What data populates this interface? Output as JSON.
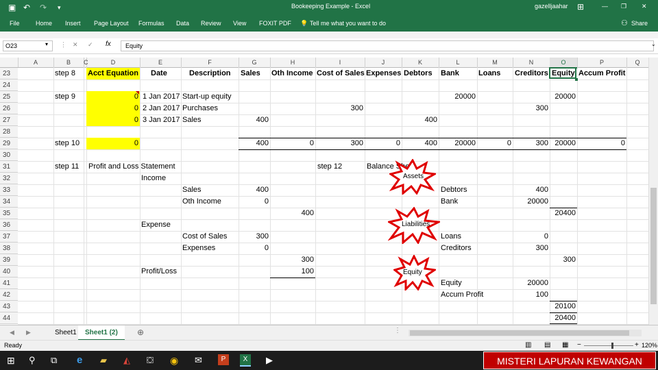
{
  "titlebar": {
    "title": "Bookeeping Example - Excel",
    "user": "gazelljaahar",
    "minimize": "—",
    "restore": "❐",
    "close": "✕"
  },
  "ribbon": {
    "tabs": [
      "File",
      "Home",
      "Insert",
      "Page Layout",
      "Formulas",
      "Data",
      "Review",
      "View",
      "FOXIT PDF"
    ],
    "tell_me": "Tell me what you want to do",
    "share": "Share"
  },
  "formula_bar": {
    "name_box": "O23",
    "fx_label": "fx",
    "value": "Equity"
  },
  "columns": [
    "A",
    "B",
    "C",
    "D",
    "E",
    "F",
    "G",
    "H",
    "I",
    "J",
    "K",
    "L",
    "M",
    "N",
    "O",
    "P",
    "Q"
  ],
  "rows": [
    "23",
    "24",
    "25",
    "26",
    "27",
    "28",
    "29",
    "30",
    "31",
    "32",
    "33",
    "34",
    "35",
    "36",
    "37",
    "38",
    "39",
    "40",
    "41",
    "42",
    "43",
    "44"
  ],
  "cells": {
    "b23": "step 8",
    "d23": "Acct Equation",
    "e23": "Date",
    "f23": "Description",
    "g23": "Sales",
    "h23": "Oth Income",
    "i23": "Cost of Sales",
    "j23": "Expenses",
    "k23": "Debtors",
    "l23": "Bank",
    "m23": "Loans",
    "n23": "Creditors",
    "o23": "Equity",
    "p23": "Accum Profit",
    "b25": "step 9",
    "d25": "0",
    "e25": "1 Jan 2017",
    "f25": "Start-up equity",
    "l25": "20000",
    "o25": "20000",
    "d26": "0",
    "e26": "2 Jan 2017",
    "f26": "Purchases",
    "i26": "300",
    "n26": "300",
    "d27": "0",
    "e27": "3 Jan 2017",
    "f27": "Sales",
    "g27": "400",
    "k27": "400",
    "b29": "step 10",
    "d29": "0",
    "g29": "400",
    "h29": "0",
    "i29": "300",
    "j29": "0",
    "k29": "400",
    "l29": "20000",
    "m29": "0",
    "n29": "300",
    "o29": "20000",
    "p29": "0",
    "b31": "step 11",
    "d31": "Profit and Loss Statement",
    "i31": "step 12",
    "j31": "Balance Sheet",
    "e32": "Income",
    "f33": "Sales",
    "g33": "400",
    "l33": "Debtors",
    "n33": "400",
    "f34": "Oth Income",
    "g34": "0",
    "l34": "Bank",
    "n34": "20000",
    "h35": "400",
    "o35": "20400",
    "e36": "Expense",
    "f37": "Cost of Sales",
    "g37": "300",
    "l37": "Loans",
    "n37": "0",
    "f38": "Expenses",
    "g38": "0",
    "l38": "Creditors",
    "n38": "300",
    "h39": "300",
    "o39": "300",
    "e40": "Profit/Loss",
    "h40": "100",
    "l41": "Equity",
    "n41": "20000",
    "l42": "Accum Profit",
    "n42": "100",
    "o43": "20100",
    "o44": "20400"
  },
  "callouts": {
    "assets": "Assets",
    "liabilities": "Liabilities",
    "equity": "Equity"
  },
  "sheet_tabs": [
    "Sheet1",
    "Sheet1 (2)"
  ],
  "status": {
    "ready": "Ready",
    "zoom": "120%"
  },
  "caption": "MISTERI LAPURAN KEWANGAN",
  "colors": {
    "excel_green": "#217346",
    "highlight": "#ffff00",
    "callout_red": "#e00000",
    "caption_red": "#c00000"
  }
}
